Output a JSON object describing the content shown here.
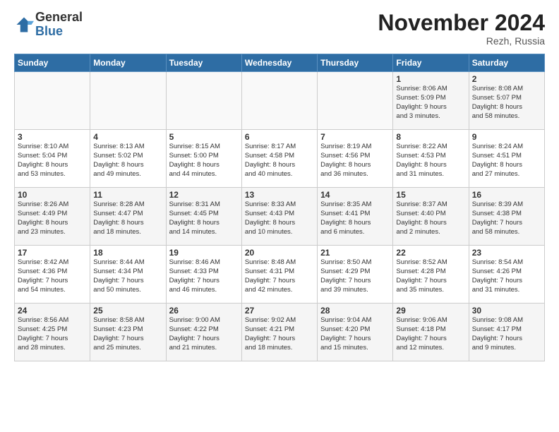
{
  "header": {
    "logo_line1": "General",
    "logo_line2": "Blue",
    "month": "November 2024",
    "location": "Rezh, Russia"
  },
  "weekdays": [
    "Sunday",
    "Monday",
    "Tuesday",
    "Wednesday",
    "Thursday",
    "Friday",
    "Saturday"
  ],
  "weeks": [
    [
      {
        "day": "",
        "info": ""
      },
      {
        "day": "",
        "info": ""
      },
      {
        "day": "",
        "info": ""
      },
      {
        "day": "",
        "info": ""
      },
      {
        "day": "",
        "info": ""
      },
      {
        "day": "1",
        "info": "Sunrise: 8:06 AM\nSunset: 5:09 PM\nDaylight: 9 hours\nand 3 minutes."
      },
      {
        "day": "2",
        "info": "Sunrise: 8:08 AM\nSunset: 5:07 PM\nDaylight: 8 hours\nand 58 minutes."
      }
    ],
    [
      {
        "day": "3",
        "info": "Sunrise: 8:10 AM\nSunset: 5:04 PM\nDaylight: 8 hours\nand 53 minutes."
      },
      {
        "day": "4",
        "info": "Sunrise: 8:13 AM\nSunset: 5:02 PM\nDaylight: 8 hours\nand 49 minutes."
      },
      {
        "day": "5",
        "info": "Sunrise: 8:15 AM\nSunset: 5:00 PM\nDaylight: 8 hours\nand 44 minutes."
      },
      {
        "day": "6",
        "info": "Sunrise: 8:17 AM\nSunset: 4:58 PM\nDaylight: 8 hours\nand 40 minutes."
      },
      {
        "day": "7",
        "info": "Sunrise: 8:19 AM\nSunset: 4:56 PM\nDaylight: 8 hours\nand 36 minutes."
      },
      {
        "day": "8",
        "info": "Sunrise: 8:22 AM\nSunset: 4:53 PM\nDaylight: 8 hours\nand 31 minutes."
      },
      {
        "day": "9",
        "info": "Sunrise: 8:24 AM\nSunset: 4:51 PM\nDaylight: 8 hours\nand 27 minutes."
      }
    ],
    [
      {
        "day": "10",
        "info": "Sunrise: 8:26 AM\nSunset: 4:49 PM\nDaylight: 8 hours\nand 23 minutes."
      },
      {
        "day": "11",
        "info": "Sunrise: 8:28 AM\nSunset: 4:47 PM\nDaylight: 8 hours\nand 18 minutes."
      },
      {
        "day": "12",
        "info": "Sunrise: 8:31 AM\nSunset: 4:45 PM\nDaylight: 8 hours\nand 14 minutes."
      },
      {
        "day": "13",
        "info": "Sunrise: 8:33 AM\nSunset: 4:43 PM\nDaylight: 8 hours\nand 10 minutes."
      },
      {
        "day": "14",
        "info": "Sunrise: 8:35 AM\nSunset: 4:41 PM\nDaylight: 8 hours\nand 6 minutes."
      },
      {
        "day": "15",
        "info": "Sunrise: 8:37 AM\nSunset: 4:40 PM\nDaylight: 8 hours\nand 2 minutes."
      },
      {
        "day": "16",
        "info": "Sunrise: 8:39 AM\nSunset: 4:38 PM\nDaylight: 7 hours\nand 58 minutes."
      }
    ],
    [
      {
        "day": "17",
        "info": "Sunrise: 8:42 AM\nSunset: 4:36 PM\nDaylight: 7 hours\nand 54 minutes."
      },
      {
        "day": "18",
        "info": "Sunrise: 8:44 AM\nSunset: 4:34 PM\nDaylight: 7 hours\nand 50 minutes."
      },
      {
        "day": "19",
        "info": "Sunrise: 8:46 AM\nSunset: 4:33 PM\nDaylight: 7 hours\nand 46 minutes."
      },
      {
        "day": "20",
        "info": "Sunrise: 8:48 AM\nSunset: 4:31 PM\nDaylight: 7 hours\nand 42 minutes."
      },
      {
        "day": "21",
        "info": "Sunrise: 8:50 AM\nSunset: 4:29 PM\nDaylight: 7 hours\nand 39 minutes."
      },
      {
        "day": "22",
        "info": "Sunrise: 8:52 AM\nSunset: 4:28 PM\nDaylight: 7 hours\nand 35 minutes."
      },
      {
        "day": "23",
        "info": "Sunrise: 8:54 AM\nSunset: 4:26 PM\nDaylight: 7 hours\nand 31 minutes."
      }
    ],
    [
      {
        "day": "24",
        "info": "Sunrise: 8:56 AM\nSunset: 4:25 PM\nDaylight: 7 hours\nand 28 minutes."
      },
      {
        "day": "25",
        "info": "Sunrise: 8:58 AM\nSunset: 4:23 PM\nDaylight: 7 hours\nand 25 minutes."
      },
      {
        "day": "26",
        "info": "Sunrise: 9:00 AM\nSunset: 4:22 PM\nDaylight: 7 hours\nand 21 minutes."
      },
      {
        "day": "27",
        "info": "Sunrise: 9:02 AM\nSunset: 4:21 PM\nDaylight: 7 hours\nand 18 minutes."
      },
      {
        "day": "28",
        "info": "Sunrise: 9:04 AM\nSunset: 4:20 PM\nDaylight: 7 hours\nand 15 minutes."
      },
      {
        "day": "29",
        "info": "Sunrise: 9:06 AM\nSunset: 4:18 PM\nDaylight: 7 hours\nand 12 minutes."
      },
      {
        "day": "30",
        "info": "Sunrise: 9:08 AM\nSunset: 4:17 PM\nDaylight: 7 hours\nand 9 minutes."
      }
    ]
  ]
}
